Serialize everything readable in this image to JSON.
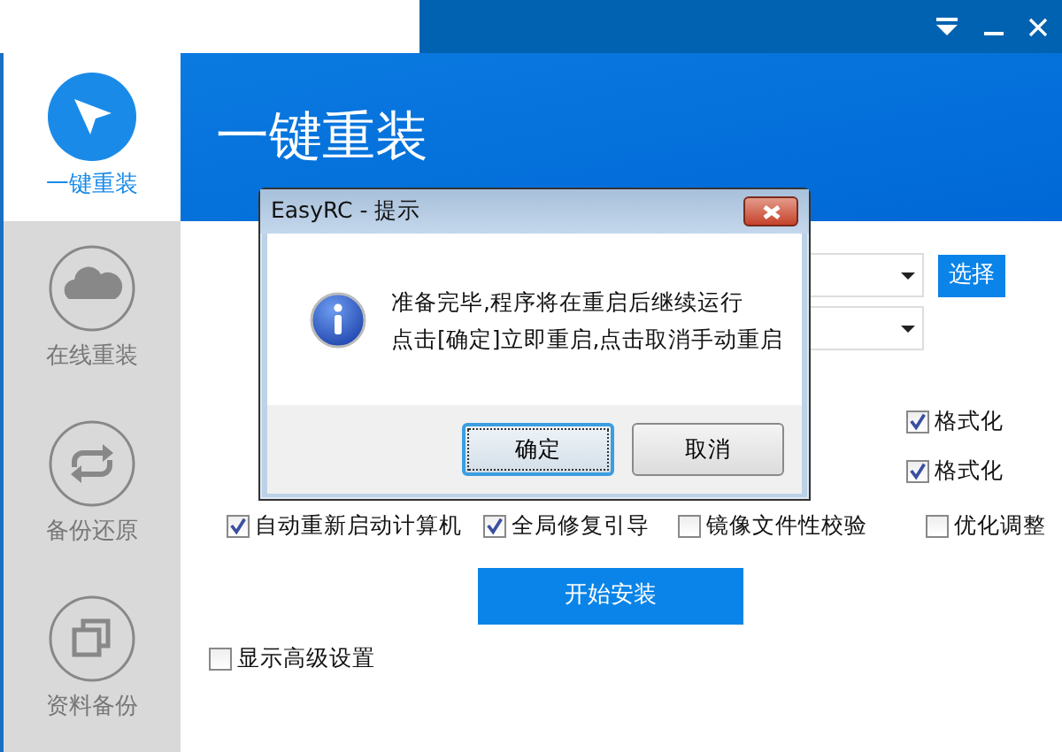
{
  "sidebar": {
    "items": [
      {
        "label": "一键重装",
        "selected": true,
        "kind": "cursor"
      },
      {
        "label": "在线重装",
        "selected": false,
        "kind": "cloud"
      },
      {
        "label": "备份还原",
        "selected": false,
        "kind": "sync"
      },
      {
        "label": "资料备份",
        "selected": false,
        "kind": "copy"
      }
    ]
  },
  "header": {
    "title": "一键重装"
  },
  "form": {
    "choose_button": "选择",
    "format_options": [
      {
        "label": "格式化",
        "checked": true
      },
      {
        "label": "格式化",
        "checked": true
      }
    ],
    "options": [
      {
        "label": "自动重新启动计算机",
        "checked": true
      },
      {
        "label": "全局修复引导",
        "checked": true
      },
      {
        "label": "镜像文件性校验",
        "checked": false
      },
      {
        "label": "优化调整",
        "checked": false
      }
    ],
    "start_button": "开始安装",
    "advanced": {
      "label": "显示高级设置",
      "checked": false
    }
  },
  "dialog": {
    "title": "EasyRC - 提示",
    "lines": [
      "准备完毕,程序将在重启后继续运行",
      "点击[确定]立即重启,点击取消手动重启"
    ],
    "buttons": [
      {
        "label": "确定",
        "focused": true
      },
      {
        "label": "取消",
        "focused": false
      }
    ]
  }
}
